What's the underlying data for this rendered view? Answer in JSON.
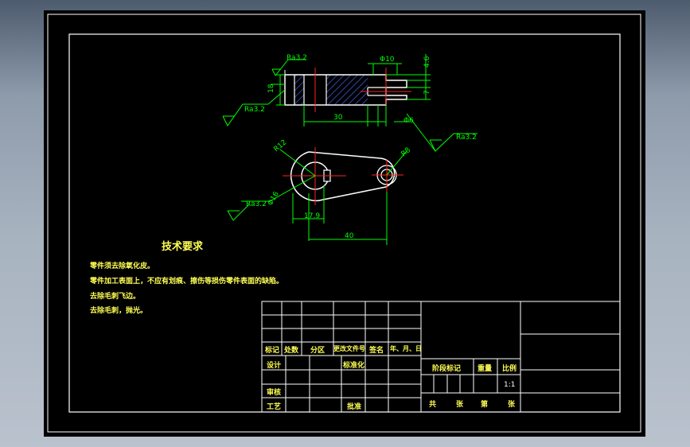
{
  "colors": {
    "background": "#000000",
    "outline": "#ffffff",
    "dimension": "#00ff00",
    "centerline": "#ff2020",
    "hatch": "#4a6cff",
    "note_text": "#ffff55",
    "title_block": "#ffffff"
  },
  "top_view": {
    "roughness_top": "Ra3.2",
    "roughness_left": "Ra3.2",
    "dim_height": "18",
    "dim_hole": "Φ10",
    "dim_thickness": "4.6",
    "dim_depth": "7",
    "dim_length": "30",
    "dim_small_hole": "Φ6",
    "roughness_right": "Ra3.2"
  },
  "front_view": {
    "dim_r_big": "R12",
    "dim_r_small": "R8",
    "dim_dia_big": "Φ16",
    "roughness_bottom": "Ra3.2",
    "dim_keyway": "17.9",
    "dim_center_distance": "40"
  },
  "notes": {
    "title": "技术要求",
    "lines": [
      "零件须去除氧化皮。",
      "零件加工表面上，不应有划痕、擦伤等损伤零件表面的缺陷。",
      "去除毛刺飞边。",
      "去除毛刺，抛光。"
    ]
  },
  "title_block": {
    "rev_headers": [
      "标记",
      "处数",
      "分区",
      "更改文件号",
      "签名",
      "年、月、日"
    ],
    "design": "设计",
    "standardize": "标准化",
    "review": "审核",
    "process": "工艺",
    "approve": "批准",
    "stage_mark": "阶段标记",
    "weight": "重量",
    "scale": "比例",
    "scale_value": "1:1",
    "total": "共",
    "sheets": "张",
    "sheet_no": "第",
    "sheet_no_suffix": "张"
  }
}
